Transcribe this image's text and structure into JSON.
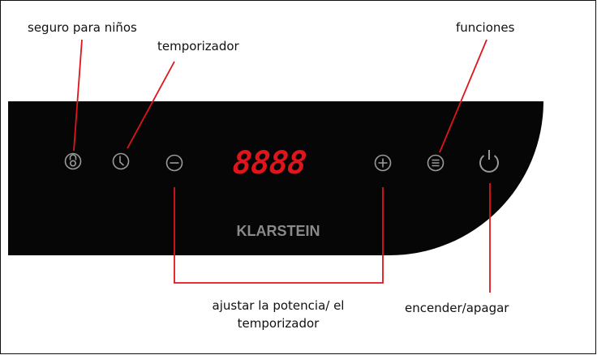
{
  "display": {
    "digits": "8888",
    "color": "#e0141b"
  },
  "brand": {
    "name": "KLARSTEIN"
  },
  "labels": {
    "child_lock": "seguro para niños",
    "timer": "temporizador",
    "functions": "funciones",
    "power": "encender/apagar",
    "adjust_line1": "ajustar la potencia/ el",
    "adjust_line2": "temporizador"
  },
  "icons": {
    "child_lock": "lock-icon",
    "timer": "clock-icon",
    "minus": "minus-icon",
    "plus": "plus-icon",
    "functions": "list-icon",
    "power": "power-icon"
  },
  "colors": {
    "panel": "#060606",
    "icon": "#9a9a9a",
    "leader_line": "#e0141b"
  }
}
